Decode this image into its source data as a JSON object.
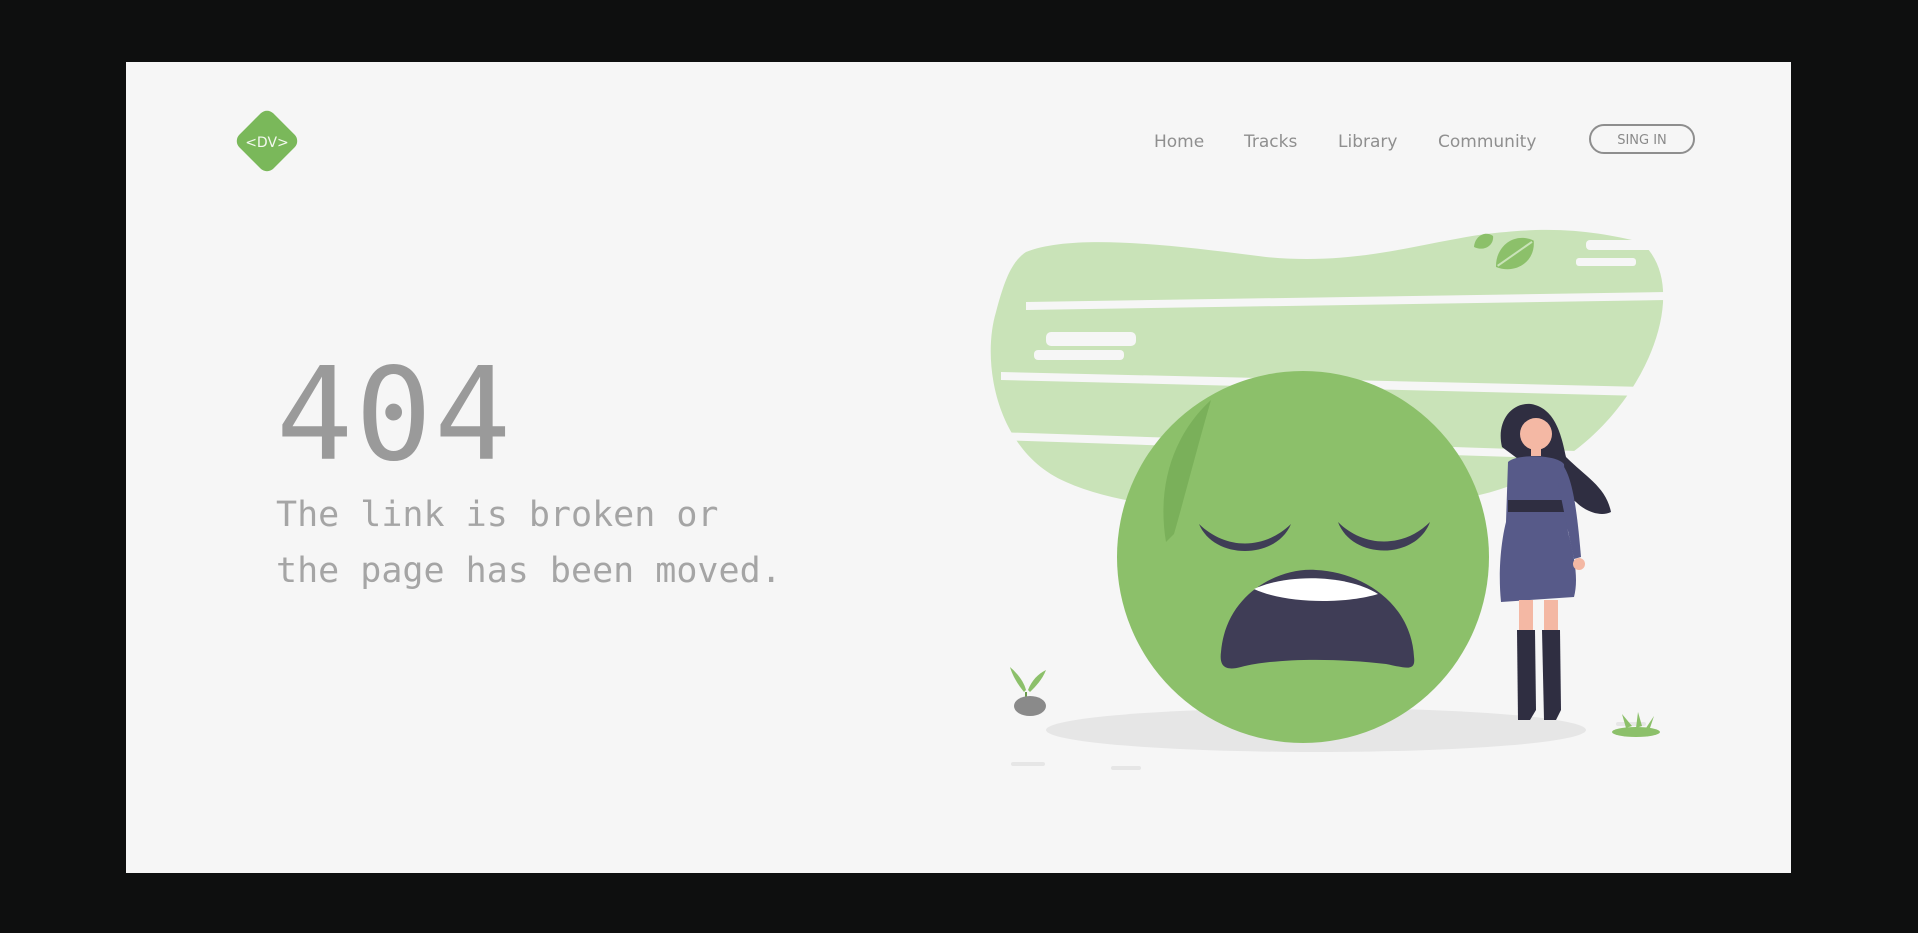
{
  "header": {
    "logo_text": "<DV>",
    "nav": {
      "home": "Home",
      "tracks": "Tracks",
      "library": "Library",
      "community": "Community"
    },
    "signin_label": "SING IN"
  },
  "error": {
    "code": "404",
    "line1": "The link is broken or",
    "line2": "the page has been moved."
  },
  "colors": {
    "accent": "#8cc06a",
    "accent_light": "#c9e3b8",
    "background": "#f6f6f6",
    "frame": "#0e0f0f"
  }
}
